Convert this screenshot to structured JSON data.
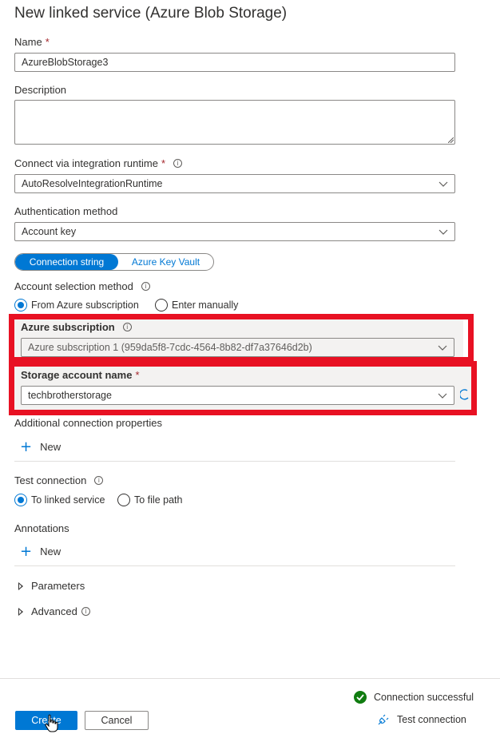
{
  "title": "New linked service (Azure Blob Storage)",
  "name": {
    "label": "Name",
    "required": "*",
    "value": "AzureBlobStorage3"
  },
  "description": {
    "label": "Description",
    "value": ""
  },
  "runtime": {
    "label": "Connect via integration runtime",
    "required": "*",
    "value": "AutoResolveIntegrationRuntime"
  },
  "auth": {
    "label": "Authentication method",
    "value": "Account key"
  },
  "toggle": {
    "connection_string": "Connection string",
    "key_vault": "Azure Key Vault",
    "selected": "Connection string"
  },
  "account_selection": {
    "label": "Account selection method",
    "options": [
      "From Azure subscription",
      "Enter manually"
    ],
    "selected": "From Azure subscription"
  },
  "subscription": {
    "label": "Azure subscription",
    "value": "Azure subscription 1 (959da5f8-7cdc-4564-8b82-df7a37646d2b)"
  },
  "storage": {
    "label": "Storage account name",
    "required": "*",
    "value": "techbrotherstorage"
  },
  "additional": {
    "label": "Additional connection properties",
    "new_label": "New"
  },
  "test_connection": {
    "label": "Test connection",
    "options": [
      "To linked service",
      "To file path"
    ],
    "selected": "To linked service"
  },
  "annotations": {
    "label": "Annotations",
    "new_label": "New"
  },
  "expanders": {
    "parameters": "Parameters",
    "advanced": "Advanced"
  },
  "footer": {
    "status": "Connection successful",
    "test_button": "Test connection",
    "create_button": "Create",
    "cancel_button": "Cancel"
  },
  "colors": {
    "accent": "#0078d4",
    "highlight_border": "#e81123",
    "success": "#107c10"
  }
}
